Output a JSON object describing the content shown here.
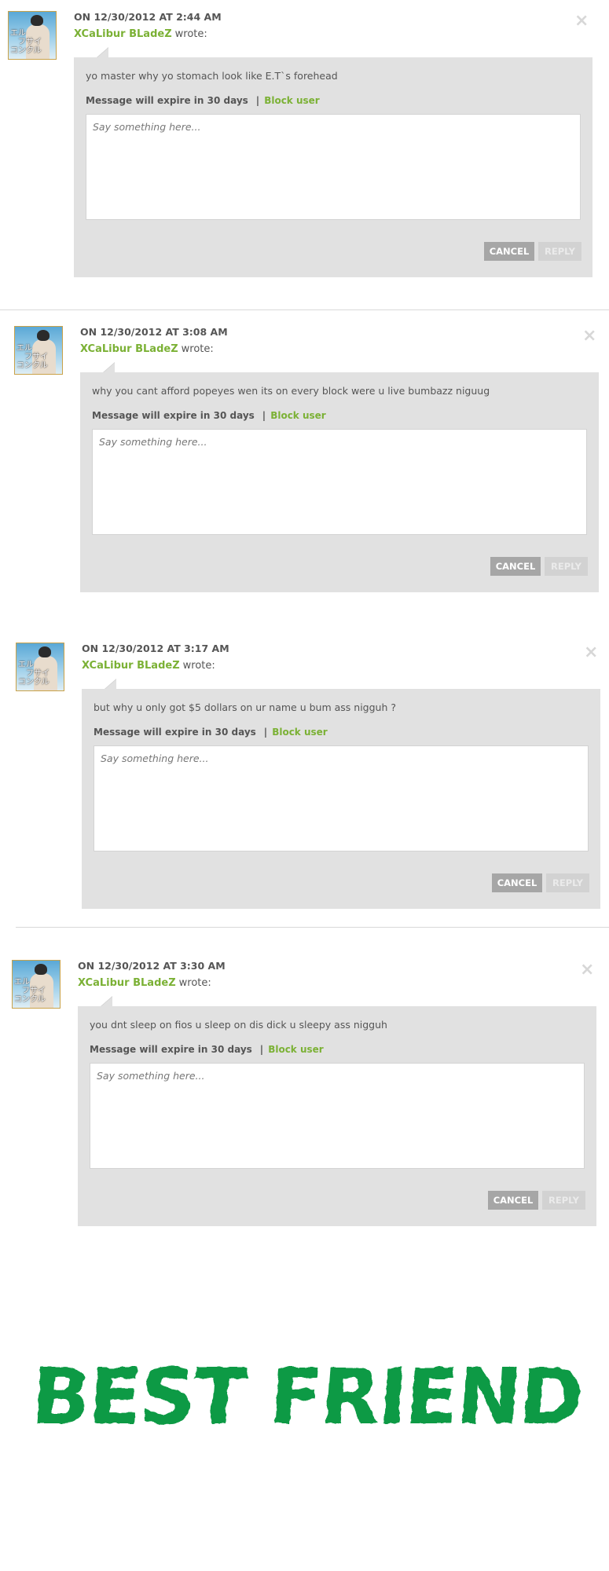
{
  "messages": [
    {
      "date": "ON 12/30/2012 AT 2:44 AM",
      "author": "XCaLibur BLadeZ",
      "wrote": "wrote:",
      "text": "yo master why yo stomach look like E.T`s forehead",
      "expire": "Message will expire in 30 days",
      "block_label": "Block user",
      "reply_placeholder": "Say something here...",
      "cancel_label": "CANCEL",
      "reply_label": "REPLY"
    },
    {
      "date": "ON 12/30/2012 AT 3:08 AM",
      "author": "XCaLibur BLadeZ",
      "wrote": "wrote:",
      "text": "why you cant afford popeyes wen its on every block were u live bumbazz niguug",
      "expire": "Message will expire in 30 days",
      "block_label": "Block user",
      "reply_placeholder": "Say something here...",
      "cancel_label": "CANCEL",
      "reply_label": "REPLY"
    },
    {
      "date": "ON 12/30/2012 AT 3:17 AM",
      "author": "XCaLibur BLadeZ",
      "wrote": "wrote:",
      "text": "but why u only got $5 dollars on ur name u bum ass nigguh ?",
      "expire": "Message will expire in 30 days",
      "block_label": "Block user",
      "reply_placeholder": "Say something here...",
      "cancel_label": "CANCEL",
      "reply_label": "REPLY"
    },
    {
      "date": "ON 12/30/2012 AT 3:30 AM",
      "author": "XCaLibur BLadeZ",
      "wrote": "wrote:",
      "text": "you dnt sleep on fios u sleep on dis dick u sleepy ass nigguh",
      "expire": "Message will expire in 30 days",
      "block_label": "Block user",
      "reply_placeholder": "Say something here...",
      "cancel_label": "CANCEL",
      "reply_label": "REPLY"
    }
  ],
  "avatar_text": "エル\nフサイ\nコンクル",
  "logo_text": "BEST FRIEND",
  "colors": {
    "accent_green": "#7bb135",
    "logo_green": "#0e9a45",
    "panel_gray": "#e1e1e1",
    "cancel_gray": "#a6a6a6",
    "reply_gray": "#d2d2d2"
  },
  "icons": {
    "close": "close-icon (×)"
  }
}
